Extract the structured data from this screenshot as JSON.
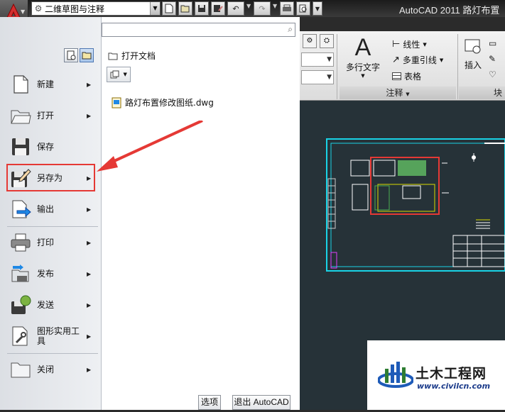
{
  "window": {
    "title": "AutoCAD 2011    路灯布置",
    "workspace": "二维草图与注释"
  },
  "quick_access": {
    "icons": [
      "new-file-icon",
      "open-file-icon",
      "save-icon",
      "save-as-icon",
      "undo-icon",
      "redo-icon",
      "plot-icon",
      "preview-icon"
    ]
  },
  "ribbon": {
    "annotation_panel": {
      "label": "注释",
      "multiline_text": "多行文字",
      "linear": "线性",
      "multileader": "多重引线",
      "table": "表格"
    },
    "block_panel": {
      "label": "块",
      "insert": "插入"
    }
  },
  "app_menu": {
    "search": {
      "placeholder": "",
      "value": ""
    },
    "items": [
      {
        "label": "新建",
        "icon": "new-file-icon",
        "has_submenu": true
      },
      {
        "label": "打开",
        "icon": "open-folder-icon",
        "has_submenu": true
      },
      {
        "label": "保存",
        "icon": "save-floppy-icon",
        "has_submenu": false
      },
      {
        "label": "另存为",
        "icon": "save-as-icon",
        "has_submenu": true,
        "highlighted": true
      },
      {
        "label": "输出",
        "icon": "export-icon",
        "has_submenu": true
      },
      {
        "label": "打印",
        "icon": "printer-icon",
        "has_submenu": true
      },
      {
        "label": "发布",
        "icon": "publish-icon",
        "has_submenu": true
      },
      {
        "label": "发送",
        "icon": "send-icon",
        "has_submenu": true
      },
      {
        "label": "图形实用工具",
        "icon": "drawing-utilities-icon",
        "has_submenu": true
      },
      {
        "label": "关闭",
        "icon": "close-file-icon",
        "has_submenu": true
      }
    ],
    "recent": {
      "header": "打开文档",
      "files": [
        {
          "name": "路灯布置修改图纸.dwg"
        }
      ]
    },
    "bottom_buttons": {
      "options": "选项",
      "exit": "退出 AutoCAD"
    }
  },
  "watermark": {
    "title": "土木工程网",
    "url": "www.civilcn.com"
  },
  "colors": {
    "highlight": "#e53935",
    "arrow": "#e53935",
    "drawing_bg": "#263238",
    "title_bar": "#2b2b2b"
  }
}
